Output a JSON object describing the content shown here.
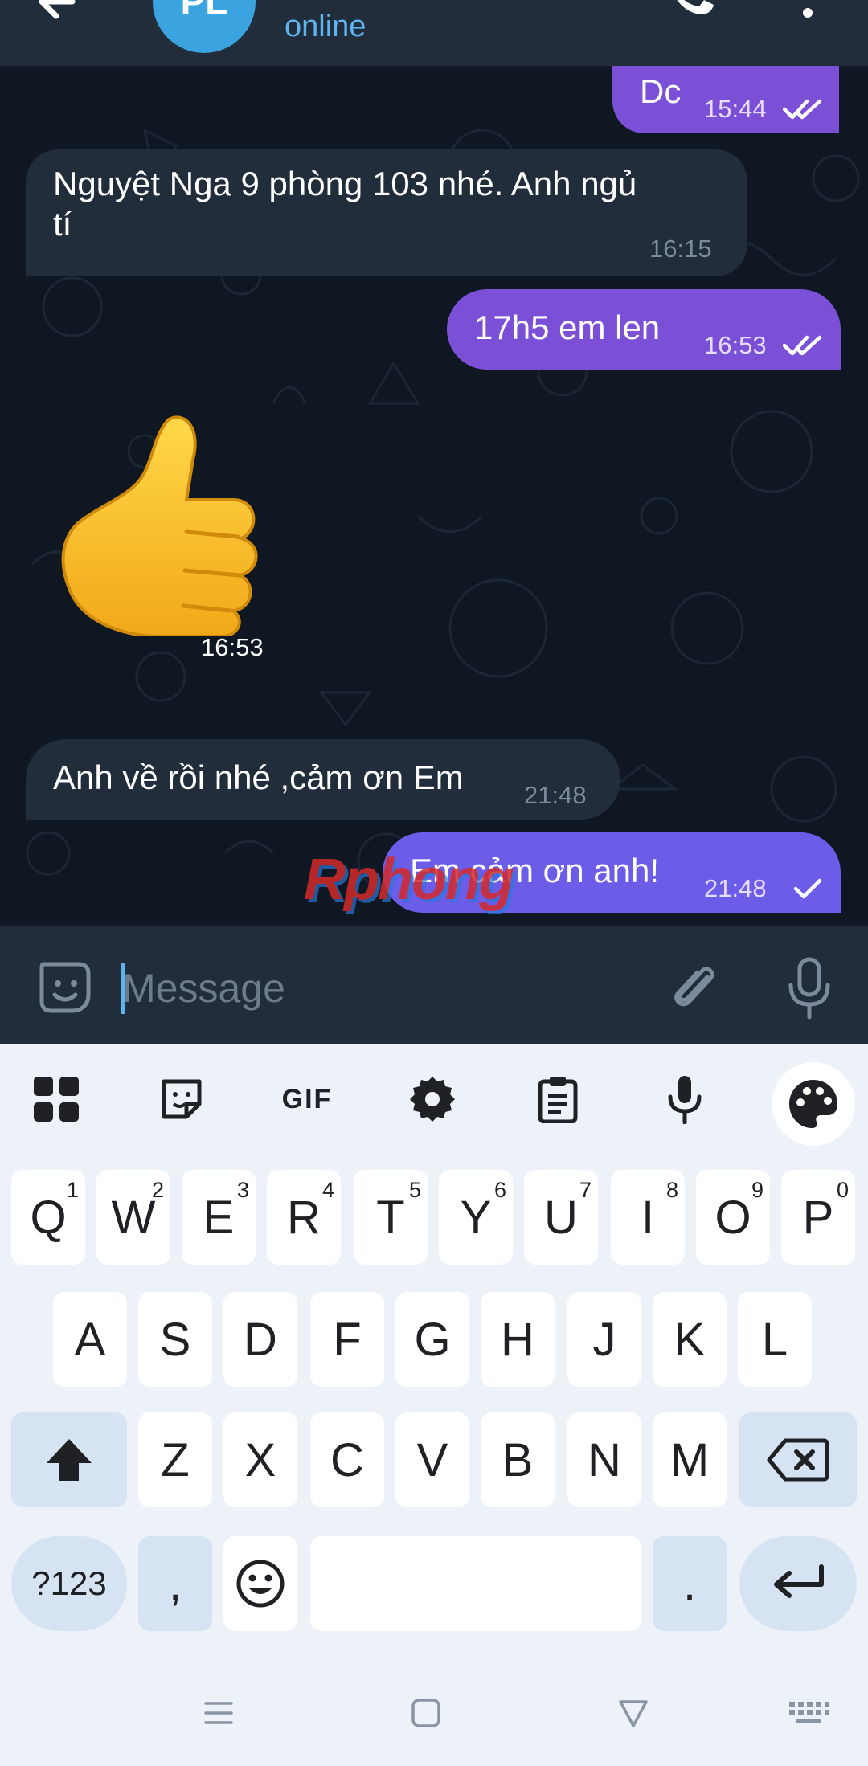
{
  "header": {
    "avatar_initials": "PL",
    "status": "online"
  },
  "messages": [
    {
      "direction": "out",
      "text": "Dc",
      "time": "15:44",
      "ticks": "double"
    },
    {
      "direction": "in",
      "text_line1": "Nguyệt Nga 9 phòng 103 nhé. Anh ngủ",
      "text_line2": "tí",
      "time": "16:15"
    },
    {
      "direction": "out",
      "text": "17h5 em len",
      "time": "16:53",
      "ticks": "double"
    },
    {
      "direction": "in",
      "type": "sticker",
      "sticker": "thumbs-up",
      "time": "16:53"
    },
    {
      "direction": "in",
      "text": "Anh về rồi nhé ,cảm ơn Em",
      "time": "21:48"
    },
    {
      "direction": "out",
      "text": "Em cảm ơn anh!",
      "time": "21:48",
      "ticks": "single"
    }
  ],
  "watermark": "Rphong",
  "input": {
    "placeholder": "Message"
  },
  "keyboard": {
    "toolbar": [
      "apps-grid",
      "sticker",
      "GIF",
      "settings",
      "clipboard",
      "voice",
      "theme-palette"
    ],
    "row1": [
      {
        "key": "Q",
        "sup": "1"
      },
      {
        "key": "W",
        "sup": "2"
      },
      {
        "key": "E",
        "sup": "3"
      },
      {
        "key": "R",
        "sup": "4"
      },
      {
        "key": "T",
        "sup": "5"
      },
      {
        "key": "Y",
        "sup": "6"
      },
      {
        "key": "U",
        "sup": "7"
      },
      {
        "key": "I",
        "sup": "8"
      },
      {
        "key": "O",
        "sup": "9"
      },
      {
        "key": "P",
        "sup": "0"
      }
    ],
    "row2": [
      "A",
      "S",
      "D",
      "F",
      "G",
      "H",
      "J",
      "K",
      "L"
    ],
    "row3": [
      "Z",
      "X",
      "C",
      "V",
      "B",
      "N",
      "M"
    ],
    "row4": {
      "symbols": "?123",
      "comma": ",",
      "period": "."
    }
  },
  "colors": {
    "header_bg": "#212d3b",
    "chat_bg": "#0f1722",
    "bubble_in": "#222d3b",
    "bubble_out": "#7b4fd6",
    "accent": "#5fb4ee",
    "keyboard_bg": "#edf2f8"
  }
}
